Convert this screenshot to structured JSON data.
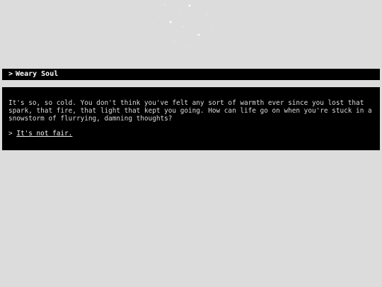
{
  "passage": {
    "title": "Weary Soul",
    "title_prompt": ">",
    "text": "It's so, so cold. You don't think you've felt any sort of warmth ever since you lost that spark, that fire, that light that kept you going. How can life go on when you're stuck in a snowstorm of flurrying, damning thoughts?",
    "choices": [
      {
        "prompt": ">",
        "label": "It's not fair."
      }
    ]
  },
  "colors": {
    "background": "#dcdcdc",
    "panel": "#000000",
    "text": "#dcdcdc",
    "title_text": "#ffffff"
  }
}
